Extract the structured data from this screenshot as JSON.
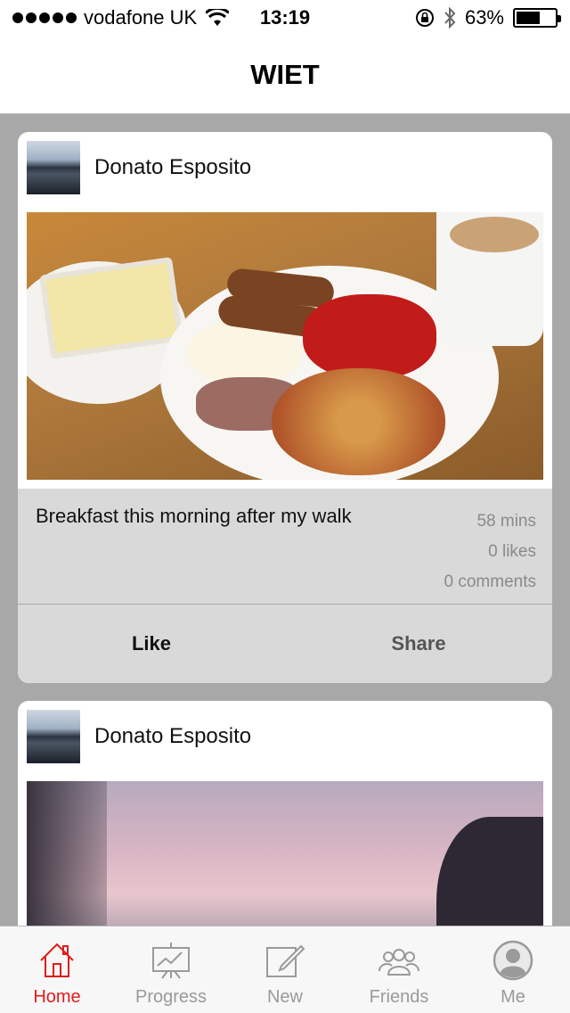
{
  "status_bar": {
    "carrier": "vodafone UK",
    "time": "13:19",
    "battery": "63%",
    "battery_level": 0.63
  },
  "nav": {
    "title": "WIET"
  },
  "posts": [
    {
      "author": "Donato Esposito",
      "caption": "Breakfast this morning after my walk",
      "time_ago": "58 mins",
      "likes": "0 likes",
      "comments": "0 comments",
      "like_label": "Like",
      "share_label": "Share"
    },
    {
      "author": "Donato Esposito"
    }
  ],
  "tabs": [
    {
      "label": "Home",
      "icon": "home-icon",
      "active": true
    },
    {
      "label": "Progress",
      "icon": "chart-easel-icon",
      "active": false
    },
    {
      "label": "New",
      "icon": "compose-icon",
      "active": false
    },
    {
      "label": "Friends",
      "icon": "friends-icon",
      "active": false
    },
    {
      "label": "Me",
      "icon": "profile-icon",
      "active": false
    }
  ],
  "colors": {
    "accent": "#e11b1b",
    "background": "#a8a8a8",
    "card_footer": "#d9d9d9"
  }
}
